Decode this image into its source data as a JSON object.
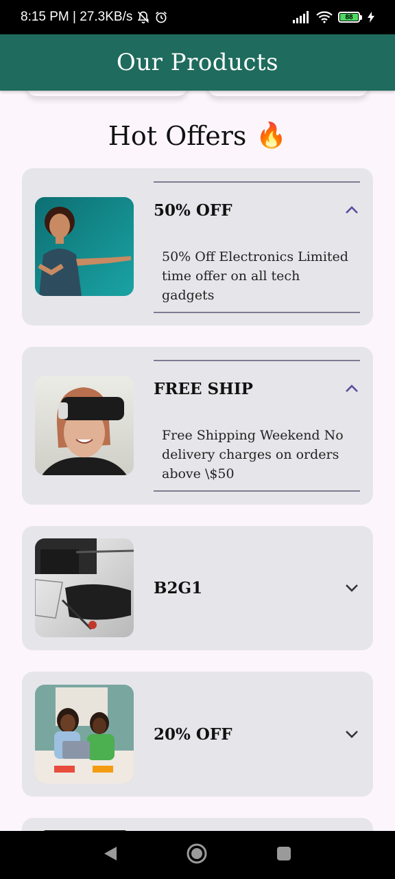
{
  "status_bar": {
    "time_info": "8:15 PM | 27.3KB/s",
    "battery": "88"
  },
  "app_bar": {
    "title": "Our Products"
  },
  "section": {
    "title": "Hot Offers",
    "emoji": "🔥"
  },
  "offers": [
    {
      "title": "50% OFF",
      "expanded": true,
      "description": "50% Off Electronics Limited time offer on all tech gadgets"
    },
    {
      "title": "FREE SHIP",
      "expanded": true,
      "description": "Free Shipping Weekend No delivery charges on orders above \\$50"
    },
    {
      "title": "B2G1",
      "expanded": false
    },
    {
      "title": "20% OFF",
      "expanded": false
    }
  ],
  "colors": {
    "app_bar": "#1f6b5d",
    "card_bg": "#e6e6ea",
    "chevron_expanded": "#5b4a9b",
    "chevron_collapsed": "#333333"
  },
  "icons": [
    "mute-icon",
    "alarm-icon",
    "signal-icon",
    "wifi-icon",
    "battery-icon",
    "charging-icon",
    "chevron-up-icon",
    "chevron-down-icon",
    "back-icon",
    "home-icon",
    "recents-icon"
  ]
}
